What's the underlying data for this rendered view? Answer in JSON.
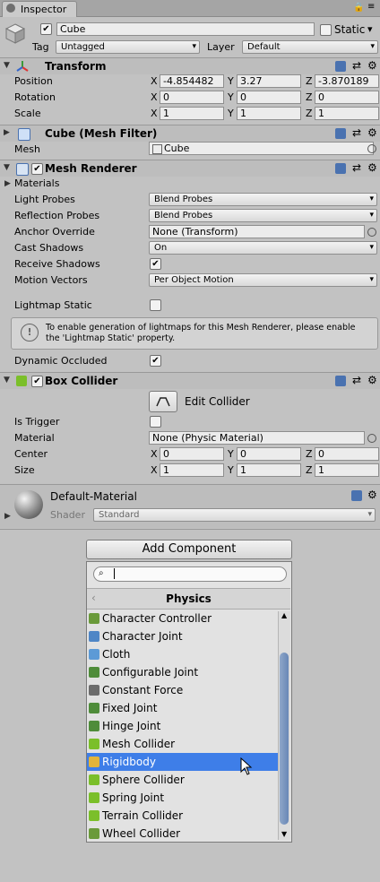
{
  "tab": {
    "label": "Inspector"
  },
  "object": {
    "name": "Cube",
    "static_label": "Static",
    "tag_label": "Tag",
    "tag_value": "Untagged",
    "layer_label": "Layer",
    "layer_value": "Default"
  },
  "transform": {
    "title": "Transform",
    "position": {
      "label": "Position",
      "x": "-4.854482",
      "y": "3.27",
      "z": "-3.870189"
    },
    "rotation": {
      "label": "Rotation",
      "x": "0",
      "y": "0",
      "z": "0"
    },
    "scale": {
      "label": "Scale",
      "x": "1",
      "y": "1",
      "z": "1"
    }
  },
  "axes": {
    "x": "X",
    "y": "Y",
    "z": "Z"
  },
  "mesh_filter": {
    "title": "Cube (Mesh Filter)",
    "mesh_label": "Mesh",
    "mesh_value": "Cube"
  },
  "mesh_renderer": {
    "title": "Mesh Renderer",
    "materials_label": "Materials",
    "light_probes_label": "Light Probes",
    "light_probes_value": "Blend Probes",
    "reflection_probes_label": "Reflection Probes",
    "reflection_probes_value": "Blend Probes",
    "anchor_override_label": "Anchor Override",
    "anchor_override_value": "None (Transform)",
    "cast_shadows_label": "Cast Shadows",
    "cast_shadows_value": "On",
    "receive_shadows_label": "Receive Shadows",
    "motion_vectors_label": "Motion Vectors",
    "motion_vectors_value": "Per Object Motion",
    "lightmap_static_label": "Lightmap Static",
    "info_text_1": "To enable generation of lightmaps for this Mesh Renderer, please enable",
    "info_text_2": "the 'Lightmap Static' property.",
    "dynamic_occluded_label": "Dynamic Occluded"
  },
  "box_collider": {
    "title": "Box Collider",
    "edit_label": "Edit Collider",
    "is_trigger_label": "Is Trigger",
    "material_label": "Material",
    "material_value": "None (Physic Material)",
    "center": {
      "label": "Center",
      "x": "0",
      "y": "0",
      "z": "0"
    },
    "size": {
      "label": "Size",
      "x": "1",
      "y": "1",
      "z": "1"
    }
  },
  "material": {
    "name": "Default-Material",
    "shader_label": "Shader",
    "shader_value": "Standard"
  },
  "add_component": {
    "button_label": "Add Component",
    "category": "Physics",
    "items": [
      {
        "label": "Character Controller",
        "icon": "character-controller-icon",
        "color": "#6a9a3a"
      },
      {
        "label": "Character Joint",
        "icon": "character-joint-icon",
        "color": "#4f86c6"
      },
      {
        "label": "Cloth",
        "icon": "cloth-icon",
        "color": "#5c9ad6"
      },
      {
        "label": "Configurable Joint",
        "icon": "configurable-joint-icon",
        "color": "#4f8c3a"
      },
      {
        "label": "Constant Force",
        "icon": "constant-force-icon",
        "color": "#6c6c6c"
      },
      {
        "label": "Fixed Joint",
        "icon": "fixed-joint-icon",
        "color": "#4f8c3a"
      },
      {
        "label": "Hinge Joint",
        "icon": "hinge-joint-icon",
        "color": "#4f8c3a"
      },
      {
        "label": "Mesh Collider",
        "icon": "mesh-collider-icon",
        "color": "#7bbf2a"
      },
      {
        "label": "Rigidbody",
        "icon": "rigidbody-icon",
        "color": "#e2b43a"
      },
      {
        "label": "Sphere Collider",
        "icon": "sphere-collider-icon",
        "color": "#7bbf2a"
      },
      {
        "label": "Spring Joint",
        "icon": "spring-joint-icon",
        "color": "#7bbf2a"
      },
      {
        "label": "Terrain Collider",
        "icon": "terrain-collider-icon",
        "color": "#7bbf2a"
      },
      {
        "label": "Wheel Collider",
        "icon": "wheel-collider-icon",
        "color": "#6a9a3a"
      }
    ],
    "selected_index": 8
  }
}
